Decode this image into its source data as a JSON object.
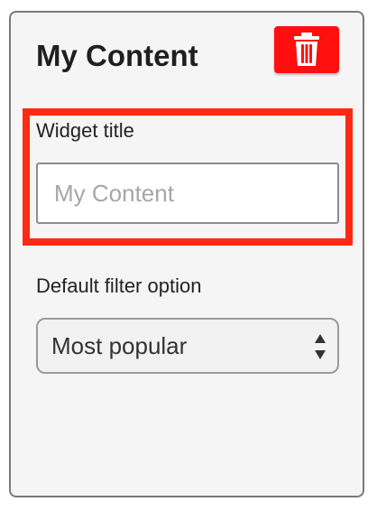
{
  "widget": {
    "heading": "My Content",
    "delete_icon": "trash-icon",
    "delete_color": "#ff0f0f",
    "highlight_color": "#ff2a13"
  },
  "title_field": {
    "label": "Widget title",
    "value": "",
    "placeholder": "My Content"
  },
  "filter_field": {
    "label": "Default filter option",
    "selected": "Most popular",
    "icon": "select-arrows-icon"
  }
}
